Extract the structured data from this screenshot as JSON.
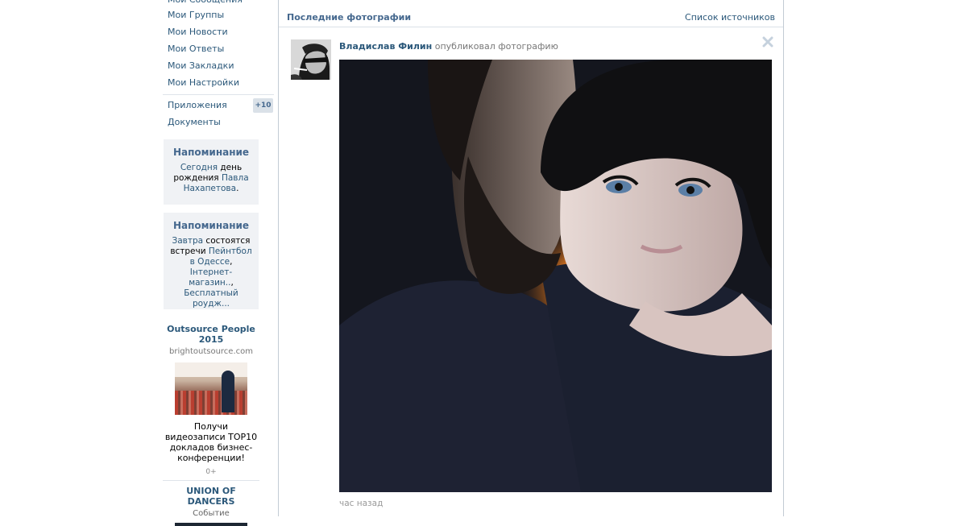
{
  "sidebar": {
    "menu": [
      {
        "label": "Мои Сообщения"
      },
      {
        "label": "Мои Группы"
      },
      {
        "label": "Мои Новости"
      },
      {
        "label": "Мои Ответы"
      },
      {
        "label": "Мои Закладки"
      },
      {
        "label": "Мои Настройки"
      },
      {
        "label": "Приложения",
        "badge": "+10"
      },
      {
        "label": "Документы"
      }
    ],
    "reminders": [
      {
        "title": "Напоминание",
        "p1": "Сегодня",
        "p2": " день рождения ",
        "p3": "Павла Нахапетова",
        "p4": "."
      },
      {
        "title": "Напоминание",
        "p1": "Завтра",
        "p2": " состоятся встречи ",
        "p3": "Пейнтбол в Одессе",
        "p4": ", ",
        "p5": "Інтернет-магазин..",
        "p6": ", ",
        "p7": "Бесплатный роудж..."
      }
    ],
    "ads": [
      {
        "title": "Outsource People 2015",
        "domain": "brightoutsource.com",
        "text": "Получи видеозаписи TOP10 докладов бизнес-конференции!",
        "age": "0+"
      },
      {
        "title": "UNION OF DANCERS",
        "subtitle": "Событие"
      }
    ]
  },
  "feed": {
    "title": "Последние фотографии",
    "sources_link": "Список источников",
    "post": {
      "author": "Владислав Филин",
      "action": "опубликовал фотографию",
      "time": "час назад"
    }
  },
  "colors": {
    "link": "#2b587a",
    "header": "#45688e",
    "muted": "#777777",
    "reminder_bg": "#f0f2f5",
    "badge_bg": "#dae1e8",
    "border": "#c3cbd4"
  },
  "icons": {
    "close": "close-icon",
    "avatar": "author-avatar"
  }
}
